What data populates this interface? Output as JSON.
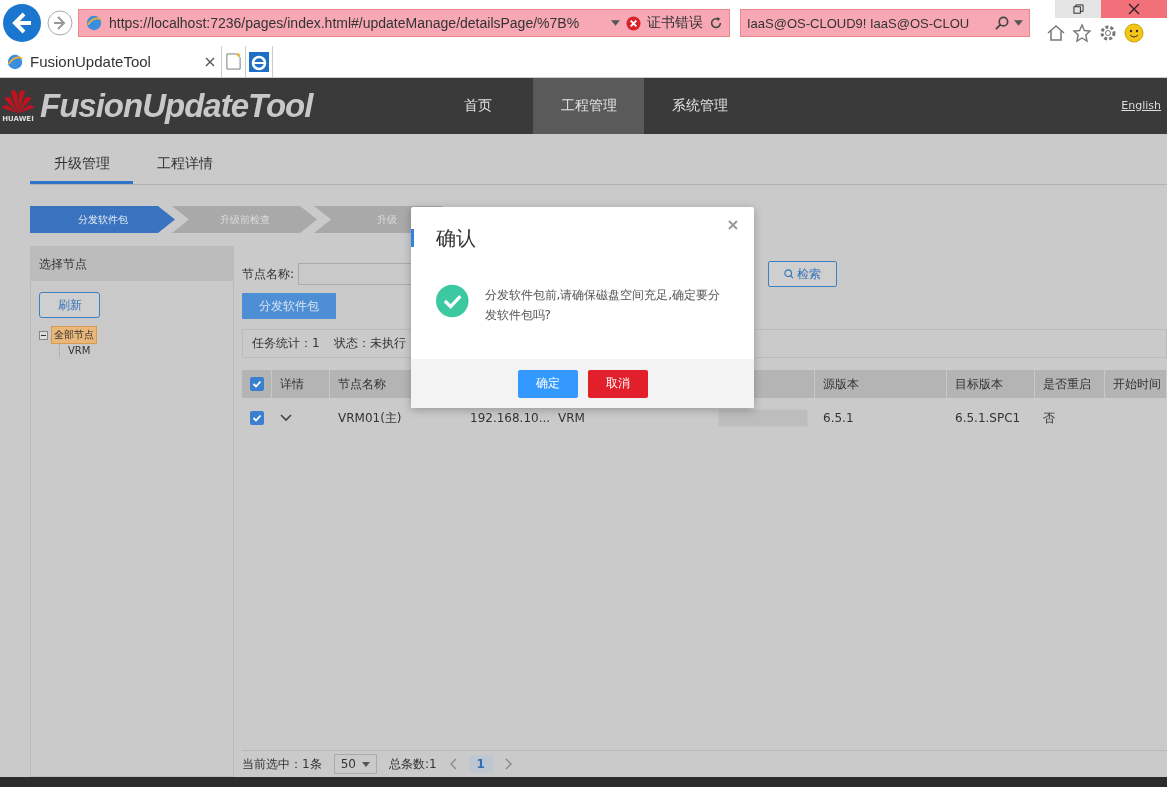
{
  "browser": {
    "address": "https://localhost:7236/pages/index.html#/updateManage/detailsPage/%7B%",
    "certificate_error": "证书错误",
    "search": "IaaS@OS-CLOUD9! IaaS@OS-CLOU",
    "tab_title": "FusionUpdateTool"
  },
  "header": {
    "logo_caption": "HUAWEI",
    "title": "FusionUpdateTool",
    "language": "English",
    "nav": [
      {
        "label": "首页",
        "selected": false
      },
      {
        "label": "工程管理",
        "selected": true
      },
      {
        "label": "系统管理",
        "selected": false
      }
    ]
  },
  "tabs": [
    {
      "label": "升级管理",
      "selected": true
    },
    {
      "label": "工程详情",
      "selected": false
    }
  ],
  "steps": [
    {
      "label": "分发软件包",
      "selected": true
    },
    {
      "label": "升级前检查",
      "selected": false
    },
    {
      "label": "升级",
      "selected": false
    }
  ],
  "node_panel": {
    "title": "选择节点",
    "refresh": "刷新",
    "tree": [
      {
        "label": "全部节点",
        "selected": true,
        "expanded": true,
        "children": [
          {
            "label": "VRM",
            "selected": false
          }
        ]
      }
    ]
  },
  "filter": {
    "label": "节点名称:",
    "search_button": "检索"
  },
  "distribute_button": "分发软件包",
  "summary": {
    "task_count": "任务统计：1",
    "status": "状态：未执行"
  },
  "table": {
    "all_checked": true,
    "columns": [
      "详情",
      "节点名称",
      "源版本",
      "目标版本",
      "是否重启",
      "开始时间"
    ],
    "rows": [
      {
        "checked": true,
        "expanded": false,
        "name": "VRM01(主)",
        "ip": "192.168.10...",
        "type": "VRM",
        "progress": {
          "level": 0
        },
        "source_version": "6.5.1",
        "target_version": "6.5.1.SPC1",
        "reboot": "否"
      }
    ]
  },
  "pagination": {
    "selected_count": "当前选中：1条",
    "page_size": "50",
    "total": "总条数:1",
    "pages": [
      {
        "label": "1",
        "selected": true
      }
    ]
  },
  "dialog": {
    "title": "确认",
    "message": "分发软件包前,请确保磁盘空间充足,确定要分发软件包吗?",
    "confirm": "确定",
    "cancel": "取消"
  }
}
